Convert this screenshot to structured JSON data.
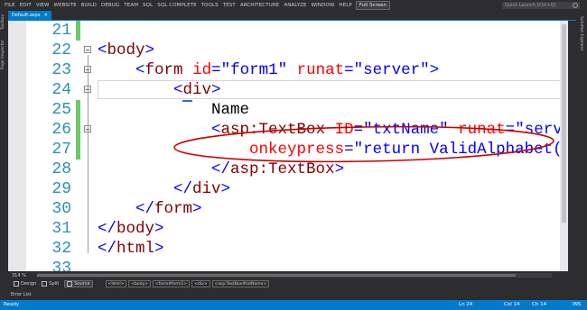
{
  "menu": [
    "FILE",
    "EDIT",
    "VIEW",
    "WEBSITE",
    "BUILD",
    "DEBUG",
    "TEAM",
    "SQL",
    "SQL COMPLETE",
    "TOOLS",
    "TEST",
    "ARCHITECTURE",
    "ANALYZE",
    "WINDOW",
    "HELP"
  ],
  "fullscreen_label": "Full Screen",
  "quick_launch_placeholder": "Quick Launch (Ctrl+Q)",
  "document_tab": "Default.aspx",
  "left_rail": [
    "Toolbox",
    "Page Inspector"
  ],
  "right_rail": "Solution Explorer",
  "code_lines": [
    {
      "num": "21",
      "text": ""
    },
    {
      "num": "22",
      "text": "<body>"
    },
    {
      "num": "23",
      "text": "    <form id=\"form1\" runat=\"server\">"
    },
    {
      "num": "24",
      "text": "        <div>"
    },
    {
      "num": "25",
      "text": "            Name"
    },
    {
      "num": "26",
      "text": "            <asp:TextBox ID=\"txtName\" runat=\"server\""
    },
    {
      "num": "27",
      "text": "                onkeypress=\"return ValidAlphabet()\">"
    },
    {
      "num": "28",
      "text": "            </asp:TextBox>"
    },
    {
      "num": "29",
      "text": "        </div>"
    },
    {
      "num": "30",
      "text": "    </form>"
    },
    {
      "num": "31",
      "text": "</body>"
    },
    {
      "num": "32",
      "text": "</html>"
    },
    {
      "num": "33",
      "text": ""
    }
  ],
  "zoom": "314 %",
  "view_buttons": {
    "design": "Design",
    "split": "Split",
    "source": "Source"
  },
  "breadcrumbs": [
    "<html>",
    "<body>",
    "<form#form1>",
    "<div>",
    "<asp:TextBox#txtName>"
  ],
  "error_list": "Error List",
  "status": {
    "ready": "Ready",
    "line": "Ln 24",
    "col": "Col 14",
    "ch": "Ch 14",
    "mode": "INS"
  },
  "colors": {
    "accent": "#007acc",
    "line_number": "#2b91af",
    "tag": "#800000",
    "attribute": "#ff0000",
    "value": "#0000ff",
    "changed": "#6ccb66",
    "annotation": "#cc0000"
  }
}
